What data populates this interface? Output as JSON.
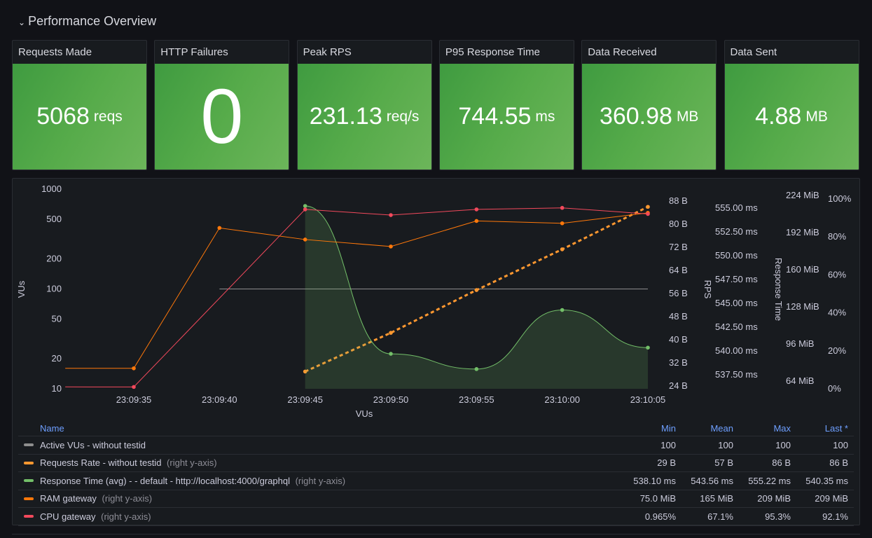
{
  "row": {
    "title": "Performance Overview",
    "icon": "chevron-down-icon"
  },
  "stats": [
    {
      "title": "Requests Made",
      "value": "5068",
      "unit": "reqs"
    },
    {
      "title": "HTTP Failures",
      "value": "0",
      "unit": ""
    },
    {
      "title": "Peak RPS",
      "value": "231.13",
      "unit": "req/s"
    },
    {
      "title": "P95 Response Time",
      "value": "744.55",
      "unit": "ms"
    },
    {
      "title": "Data Received",
      "value": "360.98",
      "unit": "MB"
    },
    {
      "title": "Data Sent",
      "value": "4.88",
      "unit": "MB"
    }
  ],
  "colors": {
    "stat_green": "#56ab4a",
    "vus": "#8e8e8e",
    "requests": "#ff9830",
    "response": "#73bf69",
    "ram": "#ff780a",
    "cpu": "#f2495c",
    "legend_header": "#6e9fff"
  },
  "chart_data": {
    "type": "line",
    "xlabel": "VUs",
    "x_ticks": [
      "23:09:35",
      "23:09:40",
      "23:09:45",
      "23:09:50",
      "23:09:55",
      "23:10:00",
      "23:10:05"
    ],
    "axes": {
      "vus": {
        "label": "VUs",
        "scale": "log",
        "range": [
          10,
          1000
        ],
        "ticks": [
          "10",
          "20",
          "50",
          "100",
          "200",
          "500",
          "1000"
        ],
        "tick_values": [
          10,
          20,
          50,
          100,
          200,
          500,
          1000
        ]
      },
      "rps": {
        "label": "RPS",
        "range": [
          24,
          88
        ],
        "ticks": [
          "24 B",
          "32 B",
          "40 B",
          "48 B",
          "56 B",
          "64 B",
          "72 B",
          "80 B",
          "88 B"
        ],
        "tick_values": [
          24,
          32,
          40,
          48,
          56,
          64,
          72,
          80,
          88
        ]
      },
      "response": {
        "label": "Response Time",
        "range": [
          535.5,
          556.5
        ],
        "ticks": [
          "537.50 ms",
          "540.00 ms",
          "542.50 ms",
          "545.00 ms",
          "547.50 ms",
          "550.00 ms",
          "552.50 ms",
          "555.00 ms"
        ],
        "tick_values": [
          537.5,
          540,
          542.5,
          545,
          547.5,
          550,
          552.5,
          555
        ]
      },
      "ram": {
        "label": "",
        "range": [
          58,
          228
        ],
        "ticks": [
          "64 MiB",
          "96 MiB",
          "128 MiB",
          "160 MiB",
          "192 MiB",
          "224 MiB"
        ],
        "tick_values": [
          64,
          96,
          128,
          160,
          192,
          224
        ]
      },
      "cpu": {
        "label": "",
        "range": [
          0,
          100
        ],
        "ticks": [
          "0%",
          "20%",
          "40%",
          "60%",
          "80%",
          "100%"
        ],
        "tick_values": [
          0,
          20,
          40,
          60,
          80,
          100
        ]
      }
    },
    "series": [
      {
        "name": "Active VUs - without testid",
        "axis": "vus",
        "style": "solid",
        "x": [
          "23:09:40",
          "23:10:05"
        ],
        "y": [
          100,
          100
        ]
      },
      {
        "name": "Requests Rate - without testid",
        "axis": "rps",
        "style": "dashed",
        "x": [
          "23:09:45",
          "23:09:50",
          "23:09:55",
          "23:10:00",
          "23:10:05"
        ],
        "y": [
          29,
          42.4,
          57.2,
          71.3,
          86
        ]
      },
      {
        "name": "Response Time (avg) - - default - http://localhost:4000/graphql",
        "axis": "response",
        "style": "smooth-area",
        "x": [
          "23:09:45",
          "23:09:50",
          "23:09:55",
          "23:10:00",
          "23:10:05"
        ],
        "y": [
          555.22,
          539.7,
          538.1,
          544.3,
          540.35
        ]
      },
      {
        "name": "RAM gateway",
        "axis": "ram",
        "style": "solid",
        "x": [
          "23:09:31",
          "23:09:35",
          "23:09:40",
          "23:09:45",
          "23:09:50",
          "23:09:55",
          "23:10:00",
          "23:10:05"
        ],
        "y": [
          75,
          75,
          196,
          186,
          180,
          202,
          200,
          209
        ]
      },
      {
        "name": "CPU gateway",
        "axis": "cpu",
        "style": "solid",
        "x": [
          "23:09:31",
          "23:09:35",
          "23:09:45",
          "23:09:50",
          "23:09:55",
          "23:10:00",
          "23:10:05"
        ],
        "y": [
          1,
          0.965,
          94.5,
          91.5,
          94.5,
          95.3,
          92.1
        ]
      }
    ]
  },
  "legend": {
    "headers": {
      "name": "Name",
      "min": "Min",
      "mean": "Mean",
      "max": "Max",
      "last": "Last *"
    },
    "rows": [
      {
        "name": "Active VUs - without testid",
        "note": "",
        "color": "#8e8e8e",
        "min": "100",
        "mean": "100",
        "max": "100",
        "last": "100"
      },
      {
        "name": "Requests Rate - without testid",
        "note": "(right y-axis)",
        "color": "#ff9830",
        "min": "29 B",
        "mean": "57 B",
        "max": "86 B",
        "last": "86 B"
      },
      {
        "name": "Response Time (avg) - - default - http://localhost:4000/graphql",
        "note": "(right y-axis)",
        "color": "#73bf69",
        "min": "538.10 ms",
        "mean": "543.56 ms",
        "max": "555.22 ms",
        "last": "540.35 ms"
      },
      {
        "name": "RAM gateway",
        "note": "(right y-axis)",
        "color": "#ff780a",
        "min": "75.0 MiB",
        "mean": "165 MiB",
        "max": "209 MiB",
        "last": "209 MiB"
      },
      {
        "name": "CPU gateway",
        "note": "(right y-axis)",
        "color": "#f2495c",
        "min": "0.965%",
        "mean": "67.1%",
        "max": "95.3%",
        "last": "92.1%"
      }
    ]
  }
}
